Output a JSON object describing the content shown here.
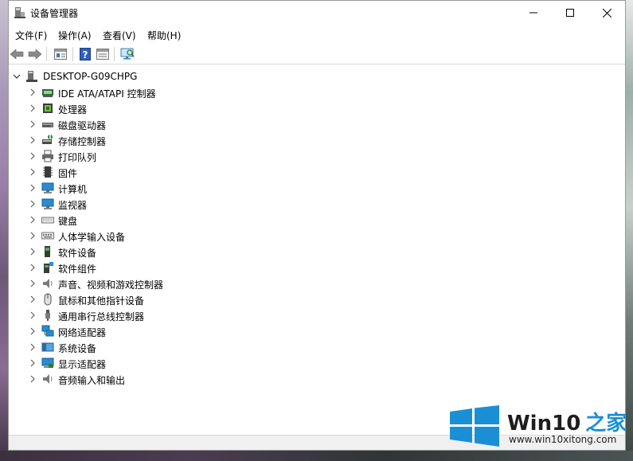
{
  "window": {
    "title": "设备管理器"
  },
  "menu": [
    {
      "label": "文件(F)"
    },
    {
      "label": "操作(A)"
    },
    {
      "label": "查看(V)"
    },
    {
      "label": "帮助(H)"
    }
  ],
  "toolbar": {
    "icons": [
      "back-arrow-icon",
      "forward-arrow-icon",
      "properties-view-icon",
      "help-icon",
      "console-tree-icon",
      "scan-hardware-icon"
    ]
  },
  "tree": {
    "root": "DESKTOP-G09CHPG",
    "items": [
      {
        "label": "IDE ATA/ATAPI 控制器",
        "icon": "ide-controller-icon"
      },
      {
        "label": "处理器",
        "icon": "processor-icon"
      },
      {
        "label": "磁盘驱动器",
        "icon": "disk-drive-icon"
      },
      {
        "label": "存储控制器",
        "icon": "storage-controller-icon"
      },
      {
        "label": "打印队列",
        "icon": "printer-icon"
      },
      {
        "label": "固件",
        "icon": "firmware-icon"
      },
      {
        "label": "计算机",
        "icon": "computer-icon"
      },
      {
        "label": "监视器",
        "icon": "monitor-icon"
      },
      {
        "label": "键盘",
        "icon": "keyboard-icon"
      },
      {
        "label": "人体学输入设备",
        "icon": "hid-icon"
      },
      {
        "label": "软件设备",
        "icon": "software-device-icon"
      },
      {
        "label": "软件组件",
        "icon": "software-component-icon"
      },
      {
        "label": "声音、视频和游戏控制器",
        "icon": "sound-icon"
      },
      {
        "label": "鼠标和其他指针设备",
        "icon": "mouse-icon"
      },
      {
        "label": "通用串行总线控制器",
        "icon": "usb-icon"
      },
      {
        "label": "网络适配器",
        "icon": "network-adapter-icon"
      },
      {
        "label": "系统设备",
        "icon": "system-device-icon"
      },
      {
        "label": "显示适配器",
        "icon": "display-adapter-icon"
      },
      {
        "label": "音频输入和输出",
        "icon": "audio-io-icon"
      }
    ]
  },
  "watermark": {
    "brand": "Win10",
    "brand_cn": "之家",
    "url": "www.win10xitong.com"
  },
  "colors": {
    "logo_blue": "#1b8fd6",
    "monitor_blue": "#2a8ad4"
  }
}
